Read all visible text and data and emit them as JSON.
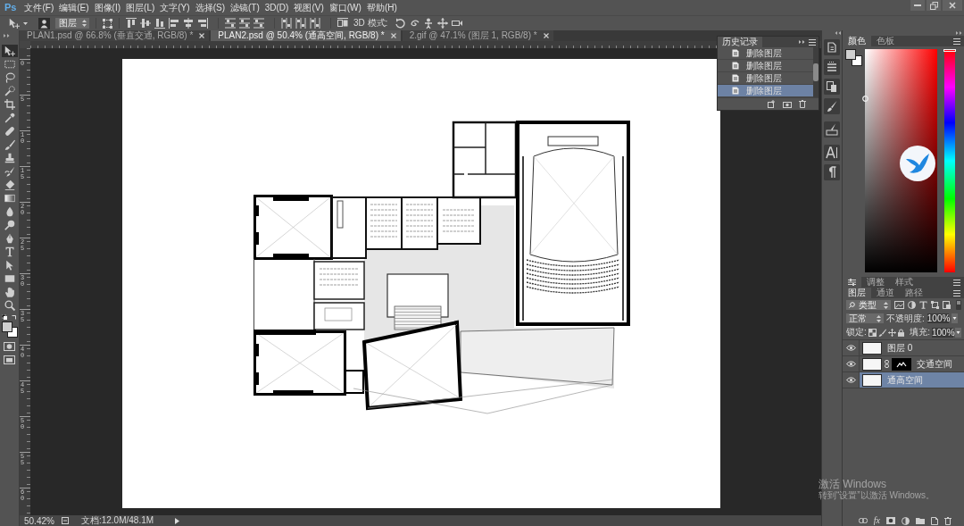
{
  "app": {
    "logo": "Ps"
  },
  "menu": [
    "文件(F)",
    "编辑(E)",
    "图像(I)",
    "图层(L)",
    "文字(Y)",
    "选择(S)",
    "滤镜(T)",
    "3D(D)",
    "视图(V)",
    "窗口(W)",
    "帮助(H)"
  ],
  "options_bar": {
    "auto_select_target": "图层",
    "mode_label": "3D 模式:"
  },
  "toolbar": {
    "tools": [
      {
        "kind": "move",
        "selected": true
      },
      {
        "kind": "marquee",
        "selected": false
      },
      {
        "kind": "lasso",
        "selected": false
      },
      {
        "kind": "quick_select",
        "selected": false
      },
      {
        "kind": "crop",
        "selected": false
      },
      {
        "kind": "eyedropper",
        "selected": false
      },
      {
        "kind": "healing",
        "selected": false
      },
      {
        "kind": "brush",
        "selected": false
      },
      {
        "kind": "stamp",
        "selected": false
      },
      {
        "kind": "history_brush",
        "selected": false
      },
      {
        "kind": "eraser",
        "selected": false
      },
      {
        "kind": "gradient",
        "selected": false
      },
      {
        "kind": "blur",
        "selected": false
      },
      {
        "kind": "dodge",
        "selected": false
      },
      {
        "kind": "pen",
        "selected": false
      },
      {
        "kind": "type",
        "selected": false
      },
      {
        "kind": "path_select",
        "selected": false
      },
      {
        "kind": "shape",
        "selected": false
      },
      {
        "kind": "hand",
        "selected": false
      },
      {
        "kind": "zoom",
        "selected": false
      }
    ]
  },
  "document_tabs": [
    {
      "label": "PLAN1.psd @ 66.8% (垂直交通, RGB/8) *",
      "selected": false
    },
    {
      "label": "PLAN2.psd @ 50.4% (通高空间, RGB/8) *",
      "selected": true
    },
    {
      "label": "2.gif @ 47.1% (图层 1, RGB/8) *",
      "selected": false
    }
  ],
  "rulers": {
    "vertical_labels": [
      "0",
      "5",
      "10",
      "15",
      "20",
      "25",
      "30",
      "35",
      "40",
      "45",
      "50",
      "55",
      "60"
    ]
  },
  "history_panel": {
    "title": "历史记录",
    "items": [
      {
        "label": "删除图层",
        "selected": false
      },
      {
        "label": "删除图层",
        "selected": false
      },
      {
        "label": "删除图层",
        "selected": false
      },
      {
        "label": "删除图层",
        "selected": true
      }
    ]
  },
  "color_panel": {
    "tabs": [
      {
        "label": "颜色",
        "selected": true
      },
      {
        "label": "色板",
        "selected": false
      }
    ],
    "hue_slider": {
      "level": 0
    }
  },
  "adjustments_panel": {
    "tabs": [
      {
        "kind": "icon",
        "selected": true
      },
      {
        "kind": "text",
        "label": "调整",
        "selected": false
      },
      {
        "kind": "text",
        "label": "样式",
        "selected": false
      }
    ]
  },
  "layers_panel": {
    "tabs": [
      {
        "label": "图层",
        "selected": true
      },
      {
        "label": "通道",
        "selected": false
      },
      {
        "label": "路径",
        "selected": false
      }
    ],
    "filter": "类型",
    "blend_mode": "正常",
    "opacity_label": "不透明度:",
    "opacity": "100%",
    "lock_label": "锁定:",
    "fill_label": "填充:",
    "fill": "100%",
    "layers": [
      {
        "name": "图层 0",
        "kind": "plain",
        "visible": true,
        "selected": false
      },
      {
        "name": "交通空间",
        "kind": "masked",
        "visible": true,
        "selected": false
      },
      {
        "name": "通高空间",
        "kind": "plain",
        "visible": true,
        "selected": true
      }
    ],
    "fx_button": "fx"
  },
  "status_bar": {
    "zoom": "50.42%",
    "document_size": "文档:12.0M/48.1M"
  },
  "activation_notice": {
    "title": "激活 Windows",
    "message": "转到“设置”以激活 Windows。"
  }
}
